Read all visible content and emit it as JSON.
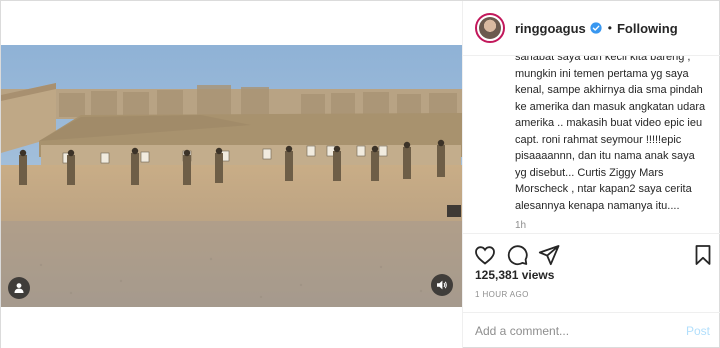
{
  "header": {
    "username": "ringgoagus",
    "separator": "•",
    "follow_state": "Following"
  },
  "caption": {
    "lines": [
      "sahabat saya dari kecil kita bareng ,",
      "mungkin ini temen pertama yg saya",
      "kenal, sampe akhirnya dia sma pindah",
      "ke amerika dan masuk angkatan udara",
      "amerika .. makasih buat video epic ieu",
      "capt. roni rahmat seymour !!!!!epic",
      "pisaaaannn, dan itu nama anak saya",
      "yg disebut... Curtis Ziggy Mars",
      "Morscheck , ntar kapan2 saya cerita",
      "alesannya kenapa namanya itu...."
    ],
    "time": "1h"
  },
  "stats": {
    "views": "125,381 views",
    "posted": "1 HOUR AGO"
  },
  "comment_box": {
    "placeholder": "Add a comment...",
    "post_label": "Post"
  },
  "icons": {
    "like": "heart-icon",
    "comment": "comment-icon",
    "share": "share-icon",
    "save": "bookmark-icon",
    "verified": "verified-badge-icon",
    "mute": "speaker-icon",
    "tagged": "person-icon"
  },
  "colors": {
    "verified_blue": "#3897f0",
    "avatar_ring": "#c2185b",
    "post_button": "#b2dffc"
  }
}
